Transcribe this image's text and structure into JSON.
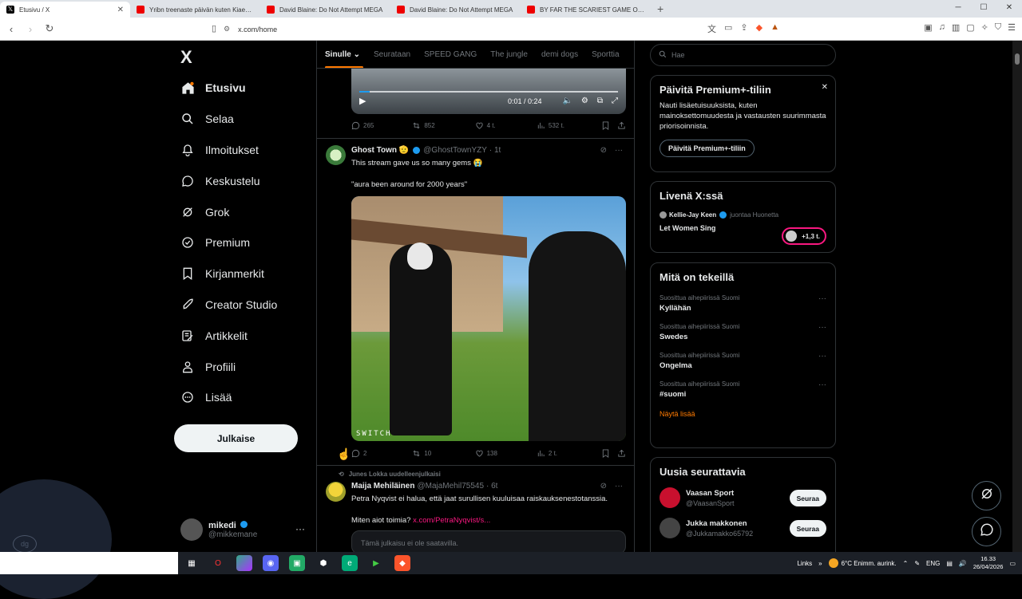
{
  "browser": {
    "tabs": [
      {
        "title": "Etusivu / X",
        "icon": "x-logo-icon",
        "active": true
      },
      {
        "title": "Yribn treenaste päivän kuten Kiaebs -",
        "icon": "youtube-icon"
      },
      {
        "title": "David Blaine: Do Not Attempt MEGA",
        "icon": "youtube-icon"
      },
      {
        "title": "David Blaine: Do Not Attempt MEGA",
        "icon": "youtube-icon"
      },
      {
        "title": "BY FAR THE SCARIEST GAME OF THE",
        "icon": "youtube-icon"
      }
    ],
    "url": "x.com/home"
  },
  "sidebar": {
    "logo": "X",
    "items": [
      {
        "label": "Etusivu",
        "icon": "home-icon"
      },
      {
        "label": "Selaa",
        "icon": "search-icon"
      },
      {
        "label": "Ilmoitukset",
        "icon": "bell-icon"
      },
      {
        "label": "Keskustelu",
        "icon": "chat-icon"
      },
      {
        "label": "Grok",
        "icon": "grok-icon"
      },
      {
        "label": "Premium",
        "icon": "premium-icon"
      },
      {
        "label": "Kirjanmerkit",
        "icon": "bookmark-icon"
      },
      {
        "label": "Creator Studio",
        "icon": "rocket-icon"
      },
      {
        "label": "Artikkelit",
        "icon": "article-icon"
      },
      {
        "label": "Profiili",
        "icon": "person-icon"
      },
      {
        "label": "Lisää",
        "icon": "more-circle-icon"
      }
    ],
    "post_button": "Julkaise",
    "account": {
      "name": "mikedi",
      "handle": "@mikkemane"
    }
  },
  "feed": {
    "tabs": [
      "Sinulle",
      "Seurataan",
      "SPEED GANG",
      "The jungle",
      "demi dogs",
      "Sporttia"
    ],
    "video1": {
      "time": "0:01 / 0:24",
      "progress": 0.04
    },
    "tweet1_actions": {
      "replies": "265",
      "retweets": "852",
      "likes": "4 t.",
      "views": "532 t."
    },
    "tweet2": {
      "name": "Ghost Town 🫡",
      "handle": "@GhostTownYZY",
      "time": "· 1t",
      "text1": "This stream gave us so many gems 😭",
      "text2": "\"aura been around for 2000 years\"",
      "media_caption": "SWITCH",
      "replies": "2",
      "retweets": "10",
      "likes": "138",
      "views": "2 t."
    },
    "tweet3": {
      "retweeted_by": "Junes Lokka uudelleenjulkaisi",
      "name": "Maija Mehiläinen",
      "handle": "@MajaMehil75545",
      "time": "· 6t",
      "text1": "Petra Nyqvist ei halua, että jaat surullisen kuuluisaa raiskauksenestotanssia.",
      "text2": "Miten aiot toimia?",
      "link": "x.com/PetraNyqvist/s...",
      "unavailable": "Tämä julkaisu ei ole saatavilla."
    }
  },
  "right": {
    "search_placeholder": "Hae",
    "premium": {
      "title": "Päivitä Premium+-tiliin",
      "body": "Nauti lisäetuisuuksista, kuten mainoksettomuudesta ja vastausten suurimmasta priorisoinnista.",
      "button": "Päivitä Premium+-tiliin"
    },
    "live": {
      "title": "Livenä X:ssä",
      "host": "Kellie-Jay Keen",
      "host_suffix": "juontaa Huonetta",
      "space": "Let Women Sing",
      "count": "+1,3 t."
    },
    "trends": {
      "title": "Mitä on tekeillä",
      "items": [
        {
          "context": "Suosittua aihepiirissä Suomi",
          "topic": "Kyllähän"
        },
        {
          "context": "Suosittua aihepiirissä Suomi",
          "topic": "Swedes"
        },
        {
          "context": "Suosittua aihepiirissä Suomi",
          "topic": "Ongelma"
        },
        {
          "context": "Suosittua aihepiirissä Suomi",
          "topic": "#suomi"
        }
      ],
      "show_more": "Näytä lisää"
    },
    "follow": {
      "title": "Uusia seurattavia",
      "users": [
        {
          "name": "Vaasan Sport",
          "handle": "@VaasanSport",
          "button": "Seuraa",
          "color": "#c8102e"
        },
        {
          "name": "Jukka makkonen",
          "handle": "@Jukkamakko65792",
          "button": "Seuraa",
          "color": "#444"
        }
      ]
    }
  },
  "taskbar": {
    "links": "Links",
    "weather": "6°C  Enimm. aurink.",
    "lang": "ENG",
    "time": "16.33",
    "date": "26/04/2026"
  },
  "colors": {
    "accent": "#ff7a00",
    "verified": "#1d9bf0",
    "live": "#f91880"
  }
}
